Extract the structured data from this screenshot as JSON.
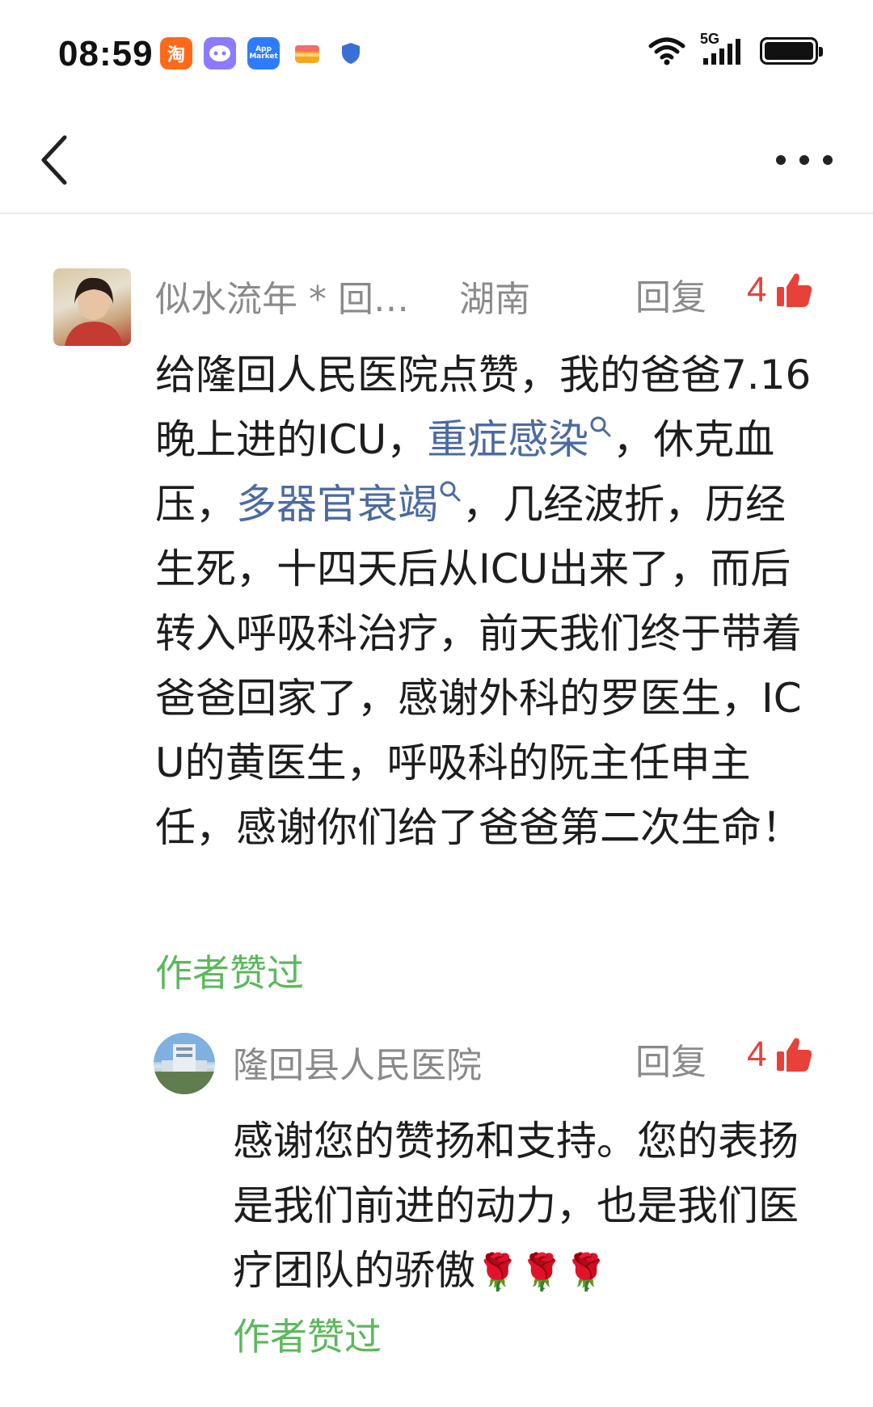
{
  "status_bar": {
    "time": "08:59",
    "taobao_icon_char": "淘",
    "network": "5G",
    "app_market_label": "App Market"
  },
  "nav": {
    "back_icon": "chevron-left-icon",
    "more_icon": "more-dots-icon"
  },
  "comments": [
    {
      "user": "似水流年 * 回…",
      "region": "湖南",
      "reply_label": "回复",
      "likes": "4",
      "text_parts": {
        "p1": "给隆回人民医院点赞，我的爸爸7.16晚上进的ICU，",
        "topic1": "重症感染",
        "p2": "，休克血压，",
        "topic2": "多器官衰竭",
        "p3": "，几经波折，历经生死，十四天后从ICU出来了，而后转入呼吸科治疗，前天我们终于带着爸爸回家了，感谢外科的罗医生，ICU的黄医生，呼吸科的阮主任申主任，感谢你们给了爸爸第二次生命！"
      },
      "author_liked": "作者赞过"
    },
    {
      "user": "隆回县人民医院",
      "reply_label": "回复",
      "likes": "4",
      "text": "感谢您的赞扬和支持。您的表扬是我们前进的动力，也是我们医疗团队的骄傲",
      "emoji": "🌹🌹🌹",
      "author_liked": "作者赞过"
    }
  ],
  "colors": {
    "like_red": "#e8413a",
    "topic_blue": "#4b6aa2",
    "author_green": "#5cb85c",
    "meta_gray": "#8a8a8a"
  }
}
